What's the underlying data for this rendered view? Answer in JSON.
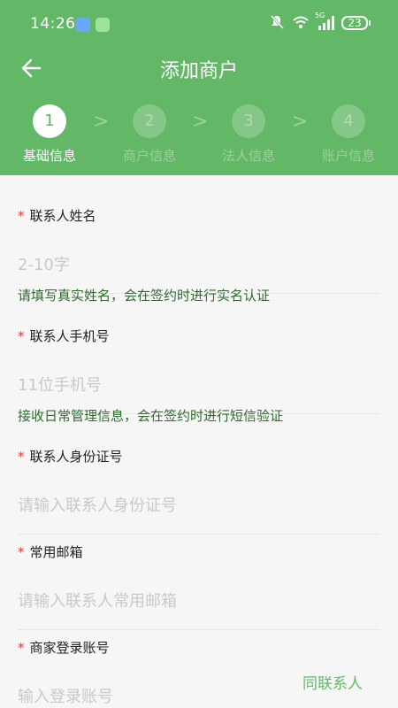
{
  "status_bar": {
    "time": "14:26",
    "network": "5G",
    "battery": "23"
  },
  "nav": {
    "title": "添加商户"
  },
  "steps": [
    {
      "number": "1",
      "label": "基础信息"
    },
    {
      "number": "2",
      "label": "商户信息"
    },
    {
      "number": "3",
      "label": "法人信息"
    },
    {
      "number": "4",
      "label": "账户信息"
    }
  ],
  "step_separator": ">",
  "required_mark": "*",
  "form": {
    "contact_name": {
      "label": "联系人姓名",
      "placeholder": "2-10字",
      "hint": "请填写真实姓名，会在签约时进行实名认证"
    },
    "contact_phone": {
      "label": "联系人手机号",
      "placeholder": "11位手机号",
      "hint": "接收日常管理信息，会在签约时进行短信验证"
    },
    "contact_id": {
      "label": "联系人身份证号",
      "placeholder": "请输入联系人身份证号"
    },
    "email": {
      "label": "常用邮箱",
      "placeholder": "请输入联系人常用邮箱"
    },
    "login_account": {
      "label": "商家登录账号",
      "placeholder": "输入登录账号",
      "same_as_contact": "同联系人"
    }
  },
  "colors": {
    "primary": "#63b868",
    "required": "#e33333",
    "hint": "#2f6b2f",
    "placeholder": "#c9c9c9"
  }
}
